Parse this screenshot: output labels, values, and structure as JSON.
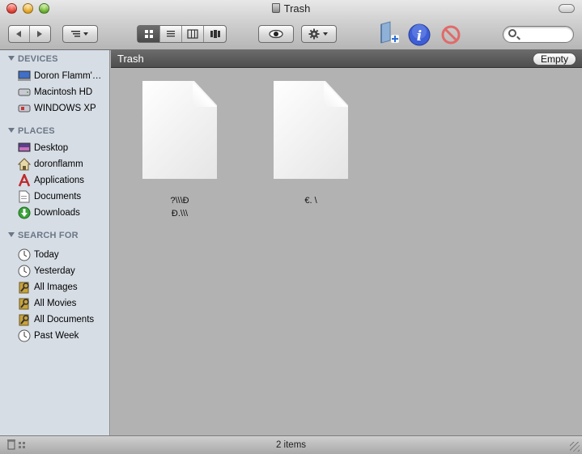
{
  "window": {
    "title": "Trash"
  },
  "toolbar": {
    "back_icon": "back-arrow-icon",
    "forward_icon": "forward-arrow-icon",
    "arrange_icon": "arrange-menu-icon",
    "views": [
      "icon-view",
      "list-view",
      "column-view",
      "coverflow-view"
    ],
    "active_view": "icon-view",
    "quicklook_icon": "eye-icon",
    "action_icon": "gear-icon",
    "search": {
      "placeholder": "",
      "value": ""
    }
  },
  "sidebar": {
    "sections": [
      {
        "title": "DEVICES",
        "items": [
          {
            "label": "Doron Flamm'…",
            "icon": "computer-icon"
          },
          {
            "label": "Macintosh HD",
            "icon": "hard-drive-icon"
          },
          {
            "label": "WINDOWS XP",
            "icon": "drive-icon"
          }
        ]
      },
      {
        "title": "PLACES",
        "items": [
          {
            "label": "Desktop",
            "icon": "desktop-icon"
          },
          {
            "label": "doronflamm",
            "icon": "home-icon"
          },
          {
            "label": "Applications",
            "icon": "applications-icon"
          },
          {
            "label": "Documents",
            "icon": "documents-icon"
          },
          {
            "label": "Downloads",
            "icon": "downloads-icon"
          }
        ]
      },
      {
        "title": "SEARCH FOR",
        "items": [
          {
            "label": "Today",
            "icon": "clock-icon"
          },
          {
            "label": "Yesterday",
            "icon": "clock-icon"
          },
          {
            "label": "All Images",
            "icon": "smart-folder-icon"
          },
          {
            "label": "All Movies",
            "icon": "smart-folder-icon"
          },
          {
            "label": "All Documents",
            "icon": "smart-folder-icon"
          },
          {
            "label": "Past Week",
            "icon": "clock-icon"
          }
        ]
      }
    ]
  },
  "pathbar": {
    "title": "Trash",
    "empty_label": "Empty"
  },
  "files": [
    {
      "name_line1": "?\\\\\\Ð",
      "name_line2": "Ð.\\\\\\"
    },
    {
      "name_line1": "€. \\",
      "name_line2": ""
    }
  ],
  "status": {
    "count": "2 items"
  }
}
